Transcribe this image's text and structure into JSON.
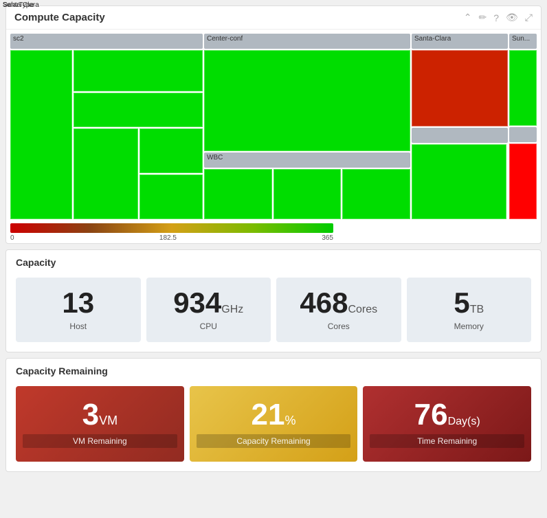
{
  "header": {
    "title": "Compute Capacity",
    "icons": [
      "chevron-up",
      "edit",
      "help",
      "eye",
      "expand"
    ]
  },
  "treemap": {
    "groups": [
      {
        "label": "sc2",
        "color": "green"
      },
      {
        "label": "Center-conf",
        "color": "green"
      },
      {
        "label": "Santa-Clara",
        "color": "green"
      },
      {
        "label": "Sunnyvale",
        "color": "green"
      },
      {
        "label": "WBC",
        "color": "green"
      },
      {
        "label": "Santa Clara",
        "color": "green"
      },
      {
        "label": "Sunnyvale",
        "color": "green"
      },
      {
        "label": "SolarType",
        "color": "green"
      }
    ]
  },
  "legend": {
    "min": "0",
    "mid": "182.5",
    "max": "365"
  },
  "capacity": {
    "title": "Capacity",
    "tiles": [
      {
        "number": "13",
        "unit": "",
        "label": "Host"
      },
      {
        "number": "934",
        "unit": "GHz",
        "label": "CPU"
      },
      {
        "number": "468",
        "unit": "Cores",
        "label": "Cores"
      },
      {
        "number": "5",
        "unit": "TB",
        "label": "Memory"
      }
    ]
  },
  "remaining": {
    "title": "Capacity Remaining",
    "tiles": [
      {
        "number": "3",
        "unit": "VM",
        "label": "VM Remaining",
        "style": "red"
      },
      {
        "number": "21",
        "unit": "%",
        "label": "Capacity Remaining",
        "style": "yellow"
      },
      {
        "number": "76",
        "unit": "Day(s)",
        "label": "Time Remaining",
        "style": "dark-red"
      }
    ]
  }
}
